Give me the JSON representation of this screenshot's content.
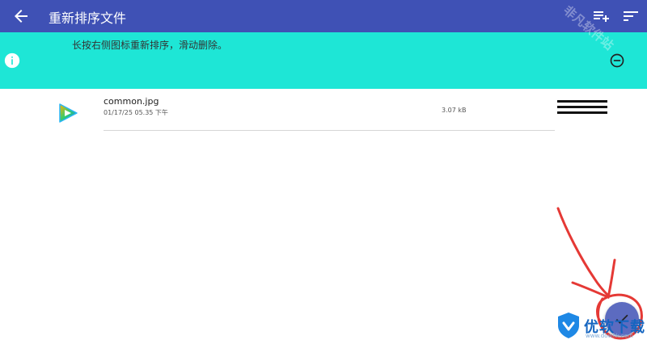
{
  "appbar": {
    "title": "重新排序文件",
    "back_icon": "arrow-back-icon",
    "actions": [
      "playlist-add-icon",
      "sort-icon"
    ],
    "color": "#3f51b5"
  },
  "banner": {
    "text": "长按右侧图标重新排序，滑动删除。",
    "info_icon": "info-icon",
    "remove_icon": "remove-circle-icon",
    "color": "#1ee6d6"
  },
  "files": [
    {
      "name": "common.jpg",
      "date": "01/17/25 05.35 下午",
      "size": "3.07 kB",
      "icon": "video-app-icon"
    }
  ],
  "fab": {
    "icon": "check-icon",
    "color": "#5c6bc0"
  },
  "watermark": {
    "corner_text": "非凡软件站",
    "logo_text": "优软下载",
    "logo_url": "www.downk.com"
  }
}
